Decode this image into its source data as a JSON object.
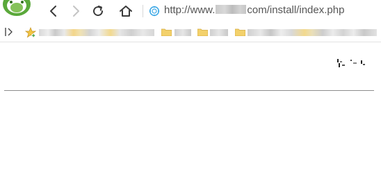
{
  "browser": {
    "url": {
      "prefix": "http://www.",
      "suffix": "com/install/index.php"
    }
  },
  "icons": {
    "logo": "browser-logo-icon",
    "back": "back-arrow-icon",
    "forward": "forward-arrow-icon",
    "reload": "reload-icon",
    "home": "home-icon",
    "site": "site-identity-icon",
    "bookmarks_toggle": "sidebar-toggle-icon",
    "favorites": "add-favorite-star-icon",
    "folder": "folder-icon"
  },
  "colors": {
    "accent_blue": "#3ea9e6",
    "logo_green": "#5aa83a",
    "folder_yellow": "#f3d16b",
    "favorite_star": "#f2c542"
  },
  "state": {
    "forward_enabled": false
  }
}
